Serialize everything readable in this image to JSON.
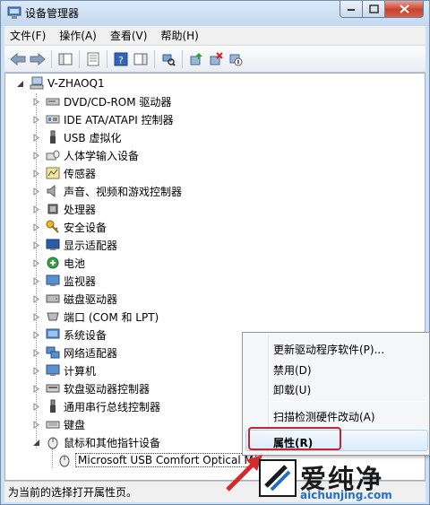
{
  "window": {
    "title": "设备管理器"
  },
  "menu": [
    "文件(F)",
    "操作(A)",
    "查看(V)",
    "帮助(H)"
  ],
  "toolbar": {
    "buttons": [
      "back-icon",
      "forward-icon",
      "show-hide-console-tree-icon",
      "properties-icon",
      "help-icon",
      "show-action-pane-icon",
      "scan-hardware-icon",
      "update-driver-icon",
      "uninstall-icon",
      "disable-icon"
    ]
  },
  "tree": {
    "root": "V-ZHAOQ1",
    "items": [
      "DVD/CD-ROM 驱动器",
      "IDE ATA/ATAPI 控制器",
      "USB 虚拟化",
      "人体学输入设备",
      "传感器",
      "声音、视频和游戏控制器",
      "处理器",
      "安全设备",
      "显示适配器",
      "电池",
      "监视器",
      "磁盘驱动器",
      "端口 (COM 和 LPT)",
      "系统设备",
      "网络适配器",
      "计算机",
      "软盘驱动器控制器",
      "通用串行总线控制器",
      "键盘",
      "鼠标和其他指针设备"
    ],
    "selected_child": "Microsoft USB Comfort Optical M"
  },
  "context_menu": {
    "update_driver": "更新驱动程序软件(P)...",
    "disable": "禁用(D)",
    "uninstall": "卸载(U)",
    "scan": "扫描检测硬件改动(A)",
    "properties": "属性(R)"
  },
  "status": {
    "text": "为当前的选择打开属性页。"
  },
  "watermark": {
    "brand": "爱纯净",
    "url": "aichunjing.com"
  }
}
